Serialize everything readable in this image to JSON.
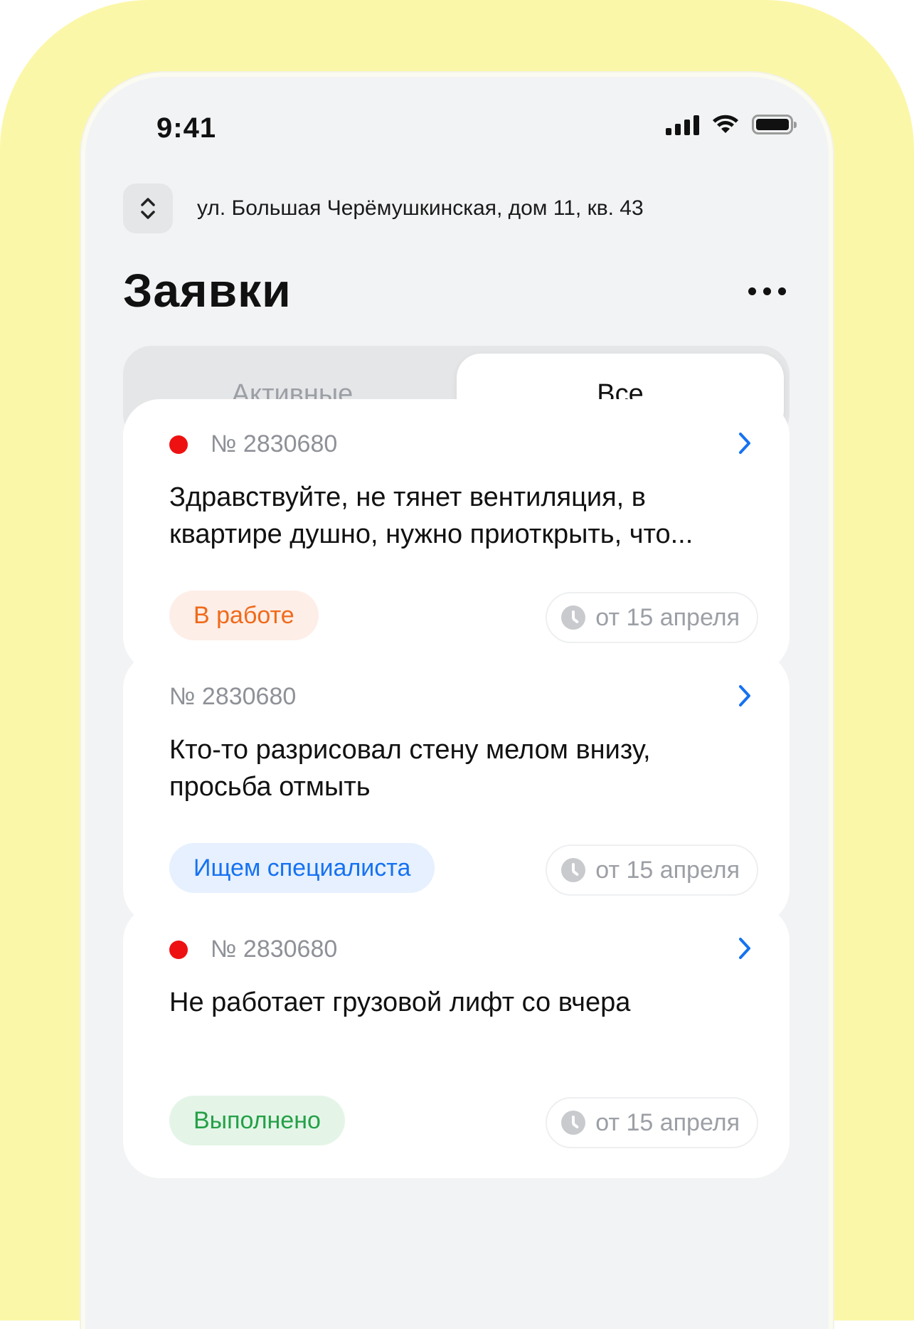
{
  "status_bar": {
    "time": "9:41",
    "icons": [
      "signal-icon",
      "wifi-icon",
      "battery-icon"
    ]
  },
  "address": {
    "icon": "chevron-up-down-icon",
    "text": "ул. Большая Черёмушкинская, дом 11, кв. 43"
  },
  "header": {
    "title": "Заявки",
    "more_icon": "more-horizontal-icon"
  },
  "tabs": [
    {
      "label": "Активные",
      "active": false
    },
    {
      "label": "Все",
      "active": true
    }
  ],
  "requests": [
    {
      "number": "№ 2830680",
      "unread": true,
      "text": "Здравствуйте, не тянет вентиляция, в квартире душно, нужно приоткрыть, что...",
      "status": "В работе",
      "status_color": "#f06a1a",
      "date": "от 15 апреля"
    },
    {
      "number": "№ 2830680",
      "unread": false,
      "text": "Кто-то разрисовал стену мелом внизу, просьба отмыть",
      "status": "Ищем специалиста",
      "status_color": "#1672f0",
      "date": "от 15 апреля"
    },
    {
      "number": "№ 2830680",
      "unread": true,
      "text": "Не работает грузовой лифт со вчера",
      "status": "Выполнено",
      "status_color": "#25a047",
      "date": "от 15 апреля"
    }
  ],
  "colors": {
    "background_accent": "#fbf7a8",
    "link_blue": "#1672f0",
    "unread_dot": "#ee1111"
  }
}
